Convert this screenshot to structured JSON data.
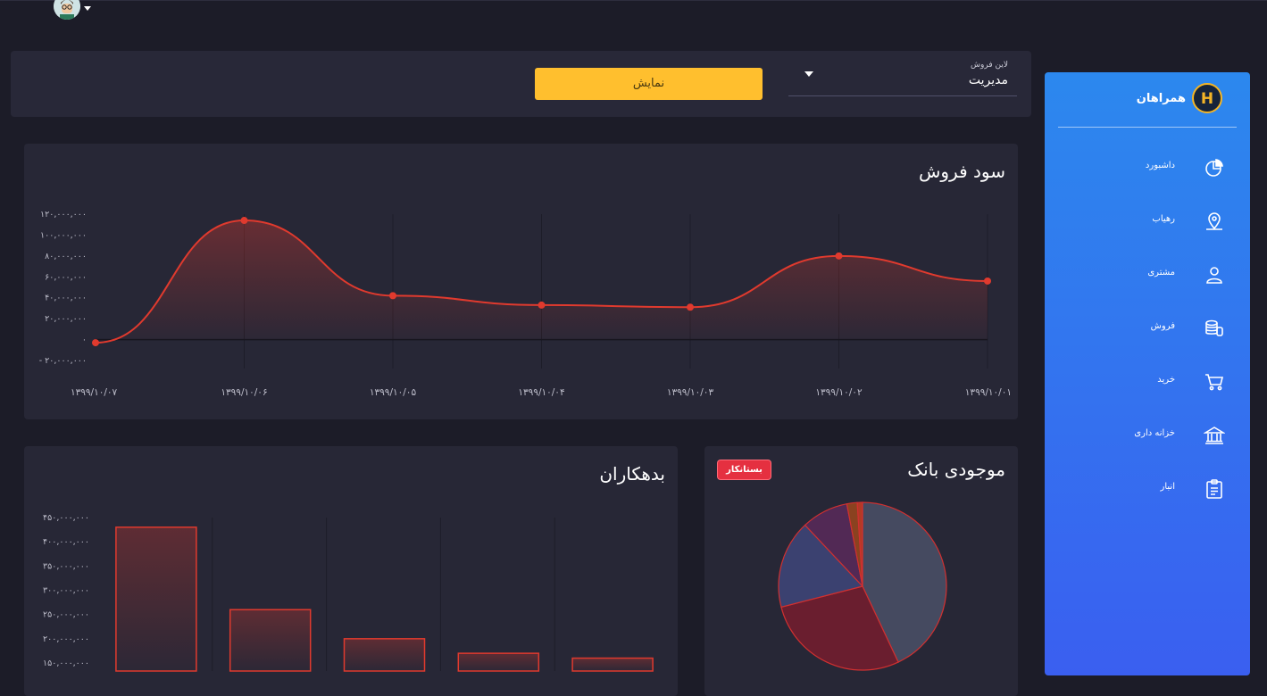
{
  "header": {
    "avatar_icon": "user-avatar-icon"
  },
  "filter": {
    "show_button": "نمایش",
    "select_label": "لاین فروش",
    "select_value": "مدیریت"
  },
  "profit": {
    "title": "سود فروش",
    "chart_data": {
      "type": "line",
      "title": "",
      "x": [
        "۱۳۹۹/۱۰/۰۷",
        "۱۳۹۹/۱۰/۰۶",
        "۱۳۹۹/۱۰/۰۵",
        "۱۳۹۹/۱۰/۰۴",
        "۱۳۹۹/۱۰/۰۳",
        "۱۳۹۹/۱۰/۰۲",
        "۱۳۹۹/۱۰/۰۱"
      ],
      "values": [
        -3000000,
        114000000,
        42000000,
        33000000,
        31000000,
        80000000,
        56000000
      ],
      "ylim": [
        -20000000,
        120000000
      ],
      "yticks": [
        120000000,
        100000000,
        80000000,
        60000000,
        40000000,
        20000000,
        0,
        -20000000
      ],
      "ytick_labels": [
        "۱۲۰,۰۰۰,۰۰۰",
        "۱۰۰,۰۰۰,۰۰۰",
        "۸۰,۰۰۰,۰۰۰",
        "۶۰,۰۰۰,۰۰۰",
        "۴۰,۰۰۰,۰۰۰",
        "۲۰,۰۰۰,۰۰۰",
        "۰",
        "- ۲۰,۰۰۰,۰۰۰"
      ],
      "color": "#e03a2e",
      "grid": true
    }
  },
  "debtors": {
    "title": "بدهکاران",
    "chart_data": {
      "type": "bar",
      "values": [
        430000000,
        260000000,
        200000000,
        170000000,
        160000000
      ],
      "ylim": [
        140000000,
        460000000
      ],
      "yticks": [
        450000000,
        400000000,
        350000000,
        300000000,
        250000000,
        200000000,
        150000000
      ],
      "ytick_labels": [
        "۴۵۰,۰۰۰,۰۰۰",
        "۴۰۰,۰۰۰,۰۰۰",
        "۳۵۰,۰۰۰,۰۰۰",
        "۳۰۰,۰۰۰,۰۰۰",
        "۲۵۰,۰۰۰,۰۰۰",
        "۲۰۰,۰۰۰,۰۰۰",
        "۱۵۰,۰۰۰,۰۰۰"
      ],
      "color": "#e03a2e",
      "grid": true
    }
  },
  "bank": {
    "title": "موجودی بانک",
    "badge": "بستانکار",
    "chart_data": {
      "type": "pie",
      "values": [
        43,
        28,
        17,
        9,
        2,
        1
      ],
      "colors": [
        "#454a60",
        "#6a1e2f",
        "#3b4170",
        "#522955",
        "#8a4220",
        "#b23a25"
      ]
    }
  },
  "sidebar": {
    "brand": "همراهان",
    "items": [
      {
        "label": "داشبورد",
        "icon": "pie-chart-icon"
      },
      {
        "label": "رهیاب",
        "icon": "map-pin-icon"
      },
      {
        "label": "مشتری",
        "icon": "user-icon"
      },
      {
        "label": "فروش",
        "icon": "coins-icon"
      },
      {
        "label": "خرید",
        "icon": "cart-icon"
      },
      {
        "label": "خزانه داری",
        "icon": "bank-icon"
      },
      {
        "label": "انبار",
        "icon": "clipboard-icon"
      }
    ]
  }
}
